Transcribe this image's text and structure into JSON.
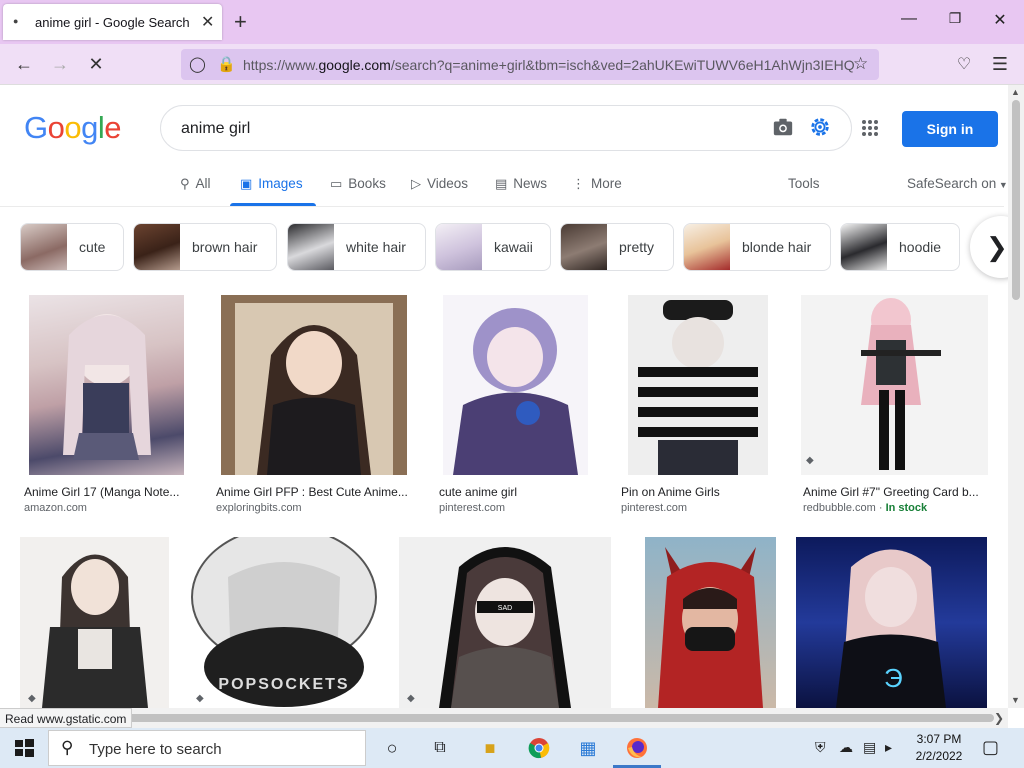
{
  "browser": {
    "tab_title": "anime girl - Google Search",
    "url_prefix": "https://www.",
    "url_domain": "google.com",
    "url_rest": "/search?q=anime+girl&tbm=isch&ved=2ahUKEwiTUWV6eH1AhWjn3IEHQ"
  },
  "google": {
    "logo_letters": [
      "G",
      "o",
      "o",
      "g",
      "l",
      "e"
    ],
    "query": "anime girl",
    "signin_label": "Sign in"
  },
  "tabs": {
    "all": "All",
    "images": "Images",
    "books": "Books",
    "videos": "Videos",
    "news": "News",
    "more": "More",
    "tools": "Tools",
    "safesearch": "SafeSearch on"
  },
  "chips": [
    "cute",
    "brown hair",
    "white hair",
    "kawaii",
    "pretty",
    "blonde hair",
    "hoodie"
  ],
  "results": [
    {
      "title": "Anime Girl 17 (Manga Note...",
      "site": "amazon.com",
      "stock": ""
    },
    {
      "title": "Anime Girl PFP : Best Cute Anime...",
      "site": "exploringbits.com",
      "stock": ""
    },
    {
      "title": "cute anime girl",
      "site": "pinterest.com",
      "stock": ""
    },
    {
      "title": "Pin on Anime Girls",
      "site": "pinterest.com",
      "stock": ""
    },
    {
      "title": "Anime Girl #7\" Greeting Card b...",
      "site": "redbubble.com",
      "stock": "In stock"
    }
  ],
  "result_row2_image_text": {
    "sad_label": "SAD",
    "popsockets": "POPSOCKETS"
  },
  "status_bar": "Read www.gstatic.com",
  "taskbar": {
    "search_placeholder": "Type here to search",
    "time": "3:07 PM",
    "date": "2/2/2022"
  },
  "colors": {
    "accent_blue": "#1a73e8",
    "chrome_purple": "#e8c7f2",
    "in_stock_green": "#188038"
  }
}
